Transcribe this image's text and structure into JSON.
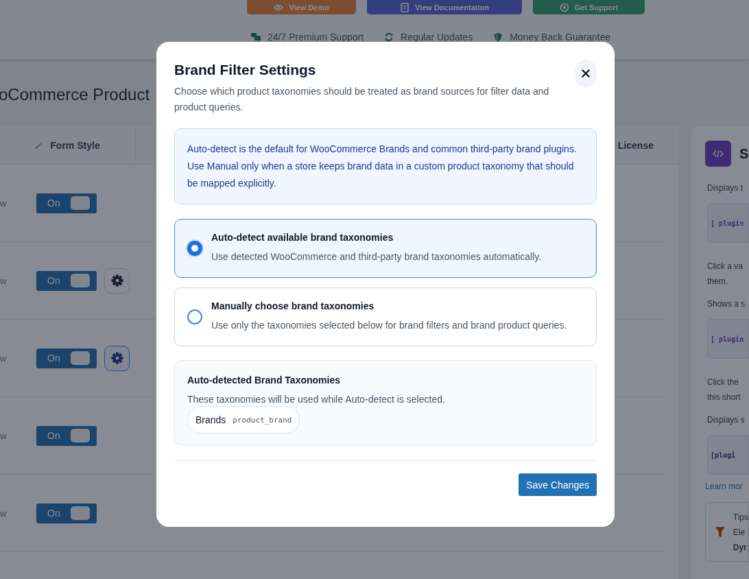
{
  "header": {
    "buttons": [
      {
        "label": "View Demo",
        "kind": "demo"
      },
      {
        "label": "View Documentation",
        "kind": "docs"
      },
      {
        "label": "Get Support",
        "kind": "support"
      }
    ],
    "features": [
      {
        "label": "24/7 Premium Support",
        "kind": "chat"
      },
      {
        "label": "Regular Updates",
        "kind": "refresh"
      },
      {
        "label": "Money Back Guarantee",
        "kind": "shield"
      }
    ]
  },
  "page_title": "oCommerce Product",
  "table": {
    "columns": [
      {
        "label": "Form Style",
        "kind": "brush"
      },
      {
        "label": "License",
        "kind": "plain"
      }
    ],
    "rows": [
      {
        "label": "w",
        "toggle": {
          "label": "On",
          "on": true
        }
      },
      {
        "label": "w",
        "toggle": {
          "label": "On",
          "on": true
        },
        "settings_button": {
          "selected": false
        }
      },
      {
        "label": "w",
        "toggle": {
          "label": "On",
          "on": true
        },
        "settings_button": {
          "selected": true
        }
      },
      {
        "label": "w",
        "toggle": {
          "label": "On",
          "on": true
        }
      },
      {
        "label": "w",
        "toggle": {
          "label": "On",
          "on": true
        }
      }
    ]
  },
  "side_panel": {
    "title": "S",
    "blocks": [
      {
        "kind": "text",
        "lines": [
          "Displays t"
        ]
      },
      {
        "kind": "code",
        "text": "[ plugin"
      },
      {
        "kind": "text",
        "lines": [
          "Click a va",
          "them."
        ]
      },
      {
        "kind": "text",
        "lines": [
          "Shows a s"
        ]
      },
      {
        "kind": "code",
        "text": "[ plugin"
      },
      {
        "kind": "text",
        "lines": [
          "Click the",
          "this short"
        ]
      },
      {
        "kind": "text",
        "lines": [
          "Displays s"
        ]
      },
      {
        "kind": "mono",
        "text": "[plugi"
      },
      {
        "kind": "link",
        "text": "Learn mor"
      }
    ],
    "tip": {
      "lines": [
        "Tips",
        "Ele"
      ],
      "bold_line": "Dyr"
    }
  },
  "modal": {
    "title": "Brand Filter Settings",
    "description": "Choose which product taxonomies should be treated as brand sources for filter data and product queries.",
    "notice": "Auto-detect is the default for WooCommerce Brands and common third-party brand plugins. Use Manual only when a store keeps brand data in a custom product taxonomy that should be mapped explicitly.",
    "options": [
      {
        "title": "Auto-detect available brand taxonomies",
        "description": "Use detected WooCommerce and third-party brand taxonomies automatically.",
        "selected": true
      },
      {
        "title": "Manually choose brand taxonomies",
        "description": "Use only the taxonomies selected below for brand filters and brand product queries.",
        "selected": false
      }
    ],
    "detected": {
      "title": "Auto-detected Brand Taxonomies",
      "description": "These taxonomies will be used while Auto-detect is selected.",
      "tags": [
        {
          "name": "Brands",
          "slug": "product_brand"
        }
      ]
    },
    "save_button": "Save Changes"
  }
}
